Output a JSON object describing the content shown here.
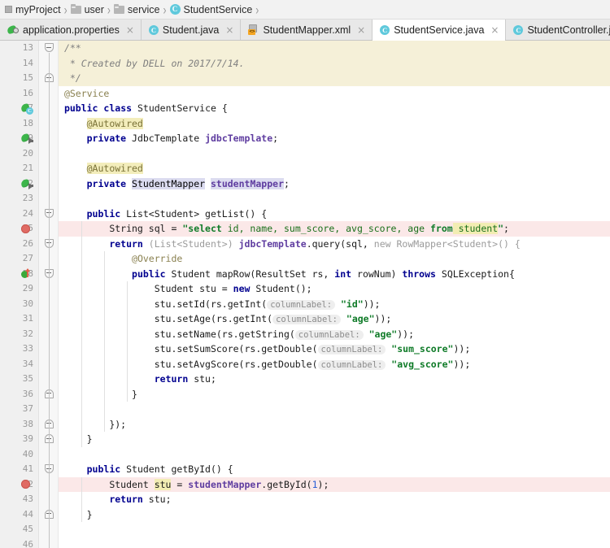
{
  "breadcrumb": {
    "name": "breadcrumb",
    "items": [
      {
        "label": "myProject",
        "icon": "module-icon"
      },
      {
        "label": "user",
        "icon": "folder-icon"
      },
      {
        "label": "service",
        "icon": "folder-icon"
      },
      {
        "label": "StudentService",
        "icon": "class-icon"
      }
    ],
    "separator": "›"
  },
  "tabs": {
    "close_glyph": "×",
    "items": [
      {
        "label": "application.properties",
        "icon": "spring-leaf-icon",
        "active": false
      },
      {
        "label": "Student.java",
        "icon": "class-icon",
        "active": false
      },
      {
        "label": "StudentMapper.xml",
        "icon": "xml-file-icon",
        "active": false
      },
      {
        "label": "StudentService.java",
        "icon": "class-icon",
        "active": true
      },
      {
        "label": "StudentController.java",
        "icon": "class-icon",
        "active": false
      }
    ]
  },
  "editor": {
    "first_line": 13,
    "last_line": 46,
    "line_numbers": [
      "13",
      "14",
      "15",
      "16",
      "17",
      "18",
      "19",
      "20",
      "21",
      "22",
      "23",
      "24",
      "25",
      "26",
      "27",
      "28",
      "29",
      "30",
      "31",
      "32",
      "33",
      "34",
      "35",
      "36",
      "37",
      "38",
      "39",
      "40",
      "41",
      "42",
      "43",
      "44",
      "45",
      "46"
    ],
    "breakpoint_lines": [
      25,
      42
    ],
    "gutter_icons": [
      {
        "line": 17,
        "icon": "spring-bean-class-icon"
      },
      {
        "line": 19,
        "icon": "spring-autowired-dependency-icon"
      },
      {
        "line": 22,
        "icon": "spring-autowired-dependency-icon"
      },
      {
        "line": 28,
        "icon": "implementing-method-icon"
      }
    ],
    "fold_markers": [
      {
        "line": 13,
        "type": "start"
      },
      {
        "line": 15,
        "type": "end"
      },
      {
        "line": 24,
        "type": "start"
      },
      {
        "line": 26,
        "type": "start"
      },
      {
        "line": 28,
        "type": "start"
      },
      {
        "line": 36,
        "type": "end"
      },
      {
        "line": 38,
        "type": "end"
      },
      {
        "line": 39,
        "type": "end"
      },
      {
        "line": 41,
        "type": "start"
      },
      {
        "line": 44,
        "type": "end"
      }
    ],
    "code_lines": [
      "/**",
      " * Created by DELL on 2017/7/14.",
      " */",
      "@Service",
      "public class StudentService {",
      "    @Autowired",
      "    private JdbcTemplate jdbcTemplate;",
      "",
      "    @Autowired",
      "    private StudentMapper studentMapper;",
      "",
      "    public List<Student> getList() {",
      "        String sql = \"select id, name, sum_score, avg_score, age from student\";",
      "        return (List<Student>) jdbcTemplate.query(sql, new RowMapper<Student>() {",
      "            @Override",
      "            public Student mapRow(ResultSet rs, int rowNum) throws SQLException{",
      "                Student stu = new Student();",
      "                stu.setId(rs.getInt( columnLabel: \"id\"));",
      "                stu.setAge(rs.getInt( columnLabel: \"age\"));",
      "                stu.setName(rs.getString( columnLabel: \"age\"));",
      "                stu.setSumScore(rs.getDouble( columnLabel: \"sum_score\"));",
      "                stu.setAvgScore(rs.getDouble( columnLabel: \"avg_score\"));",
      "                return stu;",
      "            }",
      "",
      "        });",
      "    }",
      "",
      "    public Student getById() {",
      "        Student stu = studentMapper.getById(1);",
      "        return stu;",
      "    }",
      "",
      ""
    ],
    "sql_string": {
      "open_quote": "\"",
      "keyword_select": "select",
      "columns": "id, name, sum_score, avg_score, age",
      "keyword_from": "from",
      "table": "student",
      "close_quote": "\"",
      "terminator": ";"
    },
    "parameter_hint_label": "columnLabel:",
    "highlighted_identifier": "stu",
    "highlighted_type": "StudentMapper",
    "javadoc_comment_lines": [
      "/**",
      " * Created by DELL on 2017/7/14.",
      " */"
    ]
  },
  "colors": {
    "breakpoint": "#e06b64",
    "breakpoint_row": "#fbe8e8",
    "javadoc_row": "#f5f0d8",
    "keyword": "#00008f",
    "string": "#0f7b28",
    "field": "#5f3da0",
    "annotation": "#8a8150",
    "gutter_bg": "#f0f0f0",
    "active_tab_bg": "#ffffff",
    "tabbar_bg": "#e8e8e8",
    "identifier_highlight": "#f2edb3",
    "type_highlight": "#dcdcf0",
    "spring_green": "#3cb54a",
    "class_icon_cyan": "#5fc9dc"
  }
}
